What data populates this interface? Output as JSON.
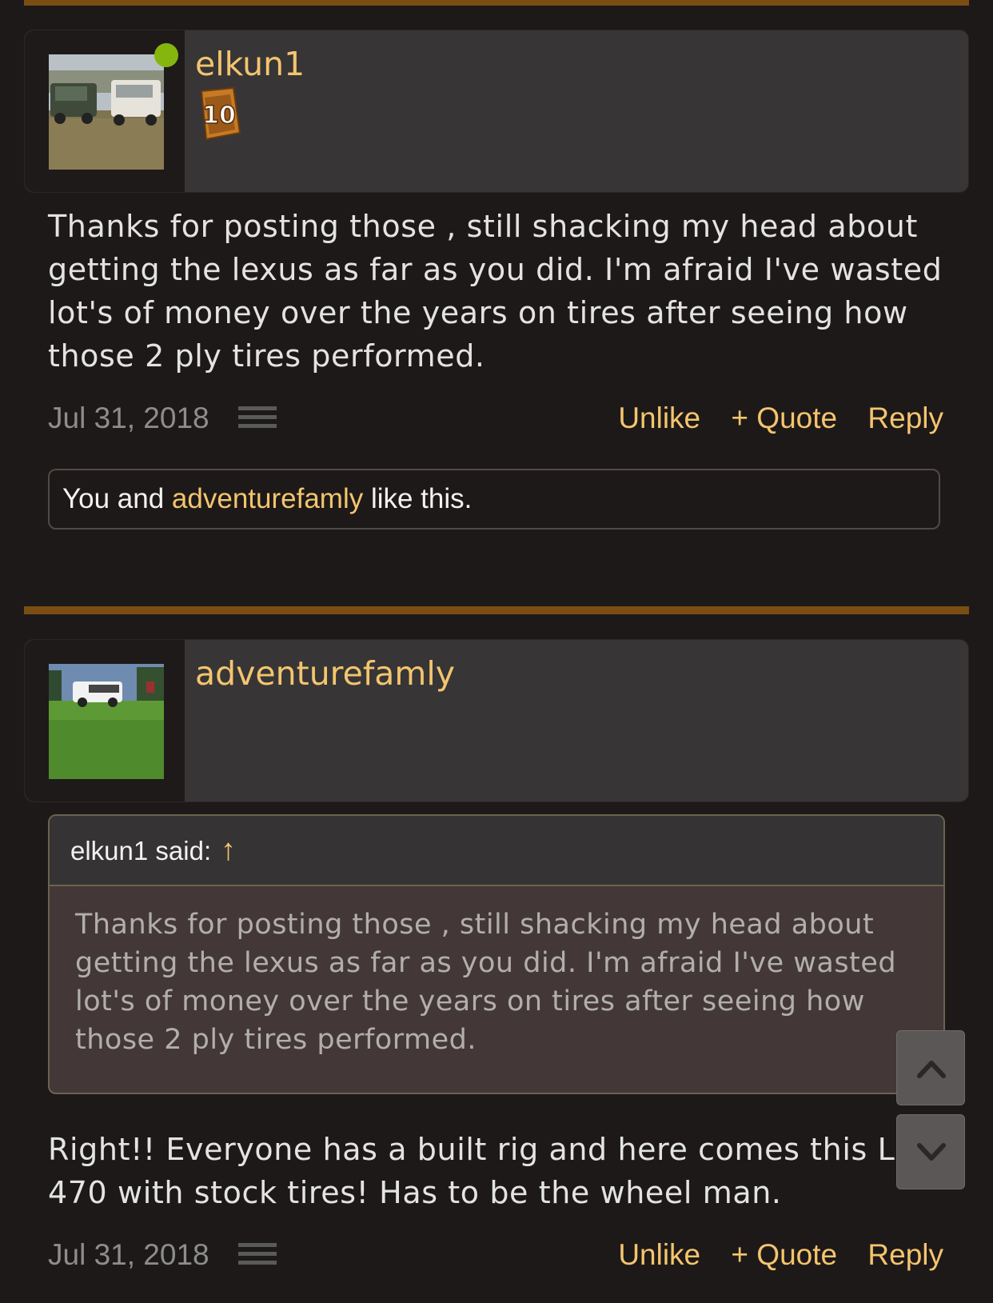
{
  "posts": [
    {
      "username": "elkun1",
      "badge_number": "10",
      "online": true,
      "message": "Thanks for posting those , still shacking my head about getting the lexus as far as you did. I'm afraid I've wasted lot's of money over the years on tires after seeing how those 2 ply tires performed.",
      "date": "Jul 31, 2018",
      "actions": {
        "unlike": "Unlike",
        "quote": "+ Quote",
        "reply": "Reply"
      },
      "likes": {
        "prefix": "You and ",
        "user": "adventurefamly",
        "suffix": " like this."
      }
    },
    {
      "username": "adventurefamly",
      "quote": {
        "author_label": "elkun1 said:",
        "arrow": "↑",
        "text": "Thanks for posting those , still shacking my head about getting the lexus as far as you did. I'm afraid I've wasted lot's of money over the years on tires after seeing how those 2 ply tires performed."
      },
      "message": "Right!! Everyone has a built rig and here comes this LX 470 with stock tires! Has to be the wheel man.",
      "date": "Jul 31, 2018",
      "actions": {
        "unlike": "Unlike",
        "quote": "+ Quote",
        "reply": "Reply"
      }
    }
  ],
  "colors": {
    "accent": "#f3c56e",
    "divider": "#7a4e12",
    "online": "#84b60d"
  },
  "icons": {
    "scroll_up": "chevron-up-icon",
    "scroll_down": "chevron-down-icon",
    "menu": "menu-icon"
  }
}
